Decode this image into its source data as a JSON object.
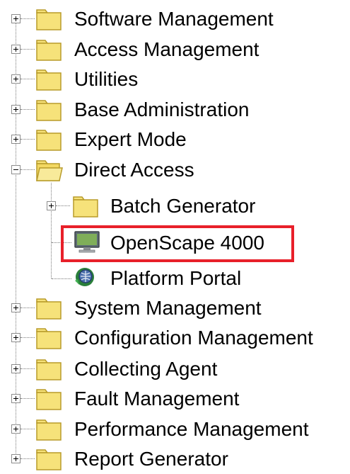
{
  "tree": {
    "top_items": [
      {
        "label": "Software Management",
        "expanded": false
      },
      {
        "label": "Access Management",
        "expanded": false
      },
      {
        "label": "Utilities",
        "expanded": false
      },
      {
        "label": "Base Administration",
        "expanded": false
      },
      {
        "label": "Expert Mode",
        "expanded": false
      },
      {
        "label": "Direct Access",
        "expanded": true
      },
      {
        "label": "System Management",
        "expanded": false
      },
      {
        "label": "Configuration Management",
        "expanded": false
      },
      {
        "label": "Collecting Agent",
        "expanded": false
      },
      {
        "label": "Fault Management",
        "expanded": false
      },
      {
        "label": "Performance Management",
        "expanded": false
      },
      {
        "label": "Report Generator",
        "expanded": false
      }
    ],
    "direct_access_children": [
      {
        "label": "Batch Generator",
        "icon": "folder-icon",
        "expanded": false
      },
      {
        "label": "OpenScape 4000",
        "icon": "monitor-icon",
        "highlighted": true
      },
      {
        "label": "Platform Portal",
        "icon": "portal-icon"
      }
    ]
  },
  "colors": {
    "folder_fill": "#f6e27a",
    "folder_stroke": "#b89b2a",
    "highlight_border": "#e8202a"
  }
}
